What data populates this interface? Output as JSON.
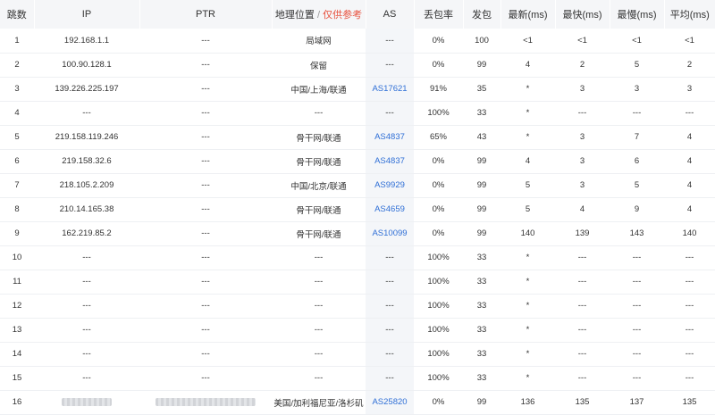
{
  "columns": {
    "hop": "跳数",
    "ip": "IP",
    "ptr": "PTR",
    "geo": "地理位置",
    "geo_sep": "/",
    "geo_note": "仅供参考",
    "as": "AS",
    "loss": "丢包率",
    "sent": "发包",
    "last": "最新(ms)",
    "best": "最快(ms)",
    "worst": "最慢(ms)",
    "avg": "平均(ms)"
  },
  "rows": [
    {
      "hop": "1",
      "ip": "192.168.1.1",
      "ptr": "---",
      "geo": "局域网",
      "as": "---",
      "as_link": false,
      "loss": "0%",
      "sent": "100",
      "last": "<1",
      "best": "<1",
      "worst": "<1",
      "avg": "<1"
    },
    {
      "hop": "2",
      "ip": "100.90.128.1",
      "ptr": "---",
      "geo": "保留",
      "as": "---",
      "as_link": false,
      "loss": "0%",
      "sent": "99",
      "last": "4",
      "best": "2",
      "worst": "5",
      "avg": "2"
    },
    {
      "hop": "3",
      "ip": "139.226.225.197",
      "ptr": "---",
      "geo": "中国/上海/联通",
      "as": "AS17621",
      "as_link": true,
      "loss": "91%",
      "sent": "35",
      "last": "*",
      "best": "3",
      "worst": "3",
      "avg": "3"
    },
    {
      "hop": "4",
      "ip": "---",
      "ptr": "---",
      "geo": "---",
      "as": "---",
      "as_link": false,
      "loss": "100%",
      "sent": "33",
      "last": "*",
      "best": "---",
      "worst": "---",
      "avg": "---"
    },
    {
      "hop": "5",
      "ip": "219.158.119.246",
      "ptr": "---",
      "geo": "骨干网/联通",
      "as": "AS4837",
      "as_link": true,
      "loss": "65%",
      "sent": "43",
      "last": "*",
      "best": "3",
      "worst": "7",
      "avg": "4"
    },
    {
      "hop": "6",
      "ip": "219.158.32.6",
      "ptr": "---",
      "geo": "骨干网/联通",
      "as": "AS4837",
      "as_link": true,
      "loss": "0%",
      "sent": "99",
      "last": "4",
      "best": "3",
      "worst": "6",
      "avg": "4"
    },
    {
      "hop": "7",
      "ip": "218.105.2.209",
      "ptr": "---",
      "geo": "中国/北京/联通",
      "as": "AS9929",
      "as_link": true,
      "loss": "0%",
      "sent": "99",
      "last": "5",
      "best": "3",
      "worst": "5",
      "avg": "4"
    },
    {
      "hop": "8",
      "ip": "210.14.165.38",
      "ptr": "---",
      "geo": "骨干网/联通",
      "as": "AS4659",
      "as_link": true,
      "loss": "0%",
      "sent": "99",
      "last": "5",
      "best": "4",
      "worst": "9",
      "avg": "4"
    },
    {
      "hop": "9",
      "ip": "162.219.85.2",
      "ptr": "---",
      "geo": "骨干网/联通",
      "as": "AS10099",
      "as_link": true,
      "loss": "0%",
      "sent": "99",
      "last": "140",
      "best": "139",
      "worst": "143",
      "avg": "140"
    },
    {
      "hop": "10",
      "ip": "---",
      "ptr": "---",
      "geo": "---",
      "as": "---",
      "as_link": false,
      "loss": "100%",
      "sent": "33",
      "last": "*",
      "best": "---",
      "worst": "---",
      "avg": "---"
    },
    {
      "hop": "11",
      "ip": "---",
      "ptr": "---",
      "geo": "---",
      "as": "---",
      "as_link": false,
      "loss": "100%",
      "sent": "33",
      "last": "*",
      "best": "---",
      "worst": "---",
      "avg": "---"
    },
    {
      "hop": "12",
      "ip": "---",
      "ptr": "---",
      "geo": "---",
      "as": "---",
      "as_link": false,
      "loss": "100%",
      "sent": "33",
      "last": "*",
      "best": "---",
      "worst": "---",
      "avg": "---"
    },
    {
      "hop": "13",
      "ip": "---",
      "ptr": "---",
      "geo": "---",
      "as": "---",
      "as_link": false,
      "loss": "100%",
      "sent": "33",
      "last": "*",
      "best": "---",
      "worst": "---",
      "avg": "---"
    },
    {
      "hop": "14",
      "ip": "---",
      "ptr": "---",
      "geo": "---",
      "as": "---",
      "as_link": false,
      "loss": "100%",
      "sent": "33",
      "last": "*",
      "best": "---",
      "worst": "---",
      "avg": "---"
    },
    {
      "hop": "15",
      "ip": "---",
      "ptr": "---",
      "geo": "---",
      "as": "---",
      "as_link": false,
      "loss": "100%",
      "sent": "33",
      "last": "*",
      "best": "---",
      "worst": "---",
      "avg": "---"
    },
    {
      "hop": "16",
      "ip": "",
      "ip_redacted": true,
      "ptr": "",
      "ptr_redacted": true,
      "geo": "美国/加利福尼亚/洛杉矶",
      "as": "AS25820",
      "as_link": true,
      "loss": "0%",
      "sent": "99",
      "last": "136",
      "best": "135",
      "worst": "137",
      "avg": "135"
    }
  ],
  "colors": {
    "link": "#2f6fd6",
    "note": "#e8523f",
    "header_bg": "#f5f6f8",
    "as_column_bg": "#f4f6f9"
  }
}
